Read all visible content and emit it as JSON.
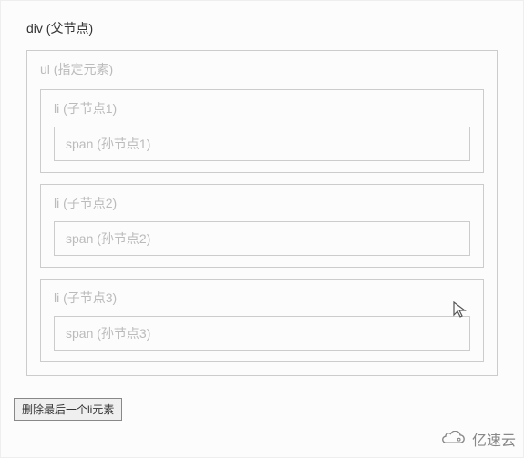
{
  "div": {
    "label": "div (父节点)"
  },
  "ul": {
    "label": "ul (指定元素)",
    "items": [
      {
        "li_label": "li (子节点1)",
        "span_label": "span (孙节点1)"
      },
      {
        "li_label": "li (子节点2)",
        "span_label": "span (孙节点2)"
      },
      {
        "li_label": "li (子节点3)",
        "span_label": "span (孙节点3)"
      }
    ]
  },
  "button": {
    "label": "删除最后一个li元素"
  },
  "watermark": {
    "text": "亿速云"
  }
}
